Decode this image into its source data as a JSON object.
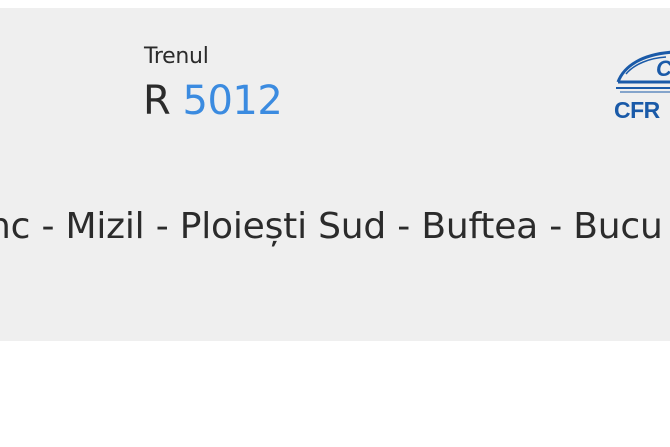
{
  "train": {
    "label": "Trenul",
    "category": "R",
    "number": "5012"
  },
  "route": {
    "text": "nc - Mizil - Ploiești Sud - Buftea - Bucu"
  },
  "logo": {
    "text": "CFR",
    "icon": "cfr-train-logo-icon"
  },
  "colors": {
    "panel": "#efefef",
    "accent": "#3b8be0",
    "logo": "#1a5aa8",
    "text": "#2b2b2b"
  }
}
